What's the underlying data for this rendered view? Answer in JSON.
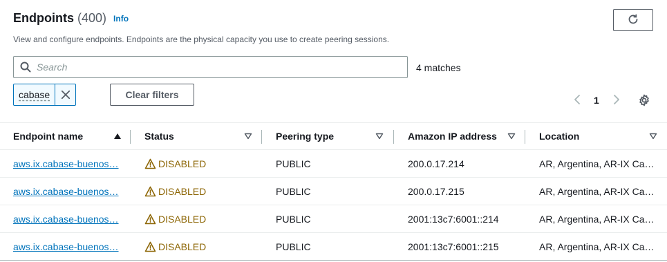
{
  "header": {
    "title": "Endpoints",
    "count": "(400)",
    "info": "Info",
    "description": "View and configure endpoints. Endpoints are the physical capacity you use to create peering sessions."
  },
  "search": {
    "placeholder": "Search",
    "matches": "4 matches"
  },
  "filter_token": {
    "label": "cabase"
  },
  "clear_filters": "Clear filters",
  "pagination": {
    "current_page": "1"
  },
  "table": {
    "columns": [
      "Endpoint name",
      "Status",
      "Peering type",
      "Amazon IP address",
      "Location"
    ],
    "rows": [
      {
        "name": "aws.ix.cabase-buenos…",
        "status": "DISABLED",
        "peering": "PUBLIC",
        "ip": "200.0.17.214",
        "location": "AR, Argentina, AR-IX Ca…"
      },
      {
        "name": "aws.ix.cabase-buenos…",
        "status": "DISABLED",
        "peering": "PUBLIC",
        "ip": "200.0.17.215",
        "location": "AR, Argentina, AR-IX Ca…"
      },
      {
        "name": "aws.ix.cabase-buenos…",
        "status": "DISABLED",
        "peering": "PUBLIC",
        "ip": "2001:13c7:6001::214",
        "location": "AR, Argentina, AR-IX Ca…"
      },
      {
        "name": "aws.ix.cabase-buenos…",
        "status": "DISABLED",
        "peering": "PUBLIC",
        "ip": "2001:13c7:6001::215",
        "location": "AR, Argentina, AR-IX Ca…"
      }
    ]
  },
  "colors": {
    "link": "#0073bb",
    "warning": "#8d6605",
    "text": "#16191f",
    "secondary": "#545b64"
  }
}
